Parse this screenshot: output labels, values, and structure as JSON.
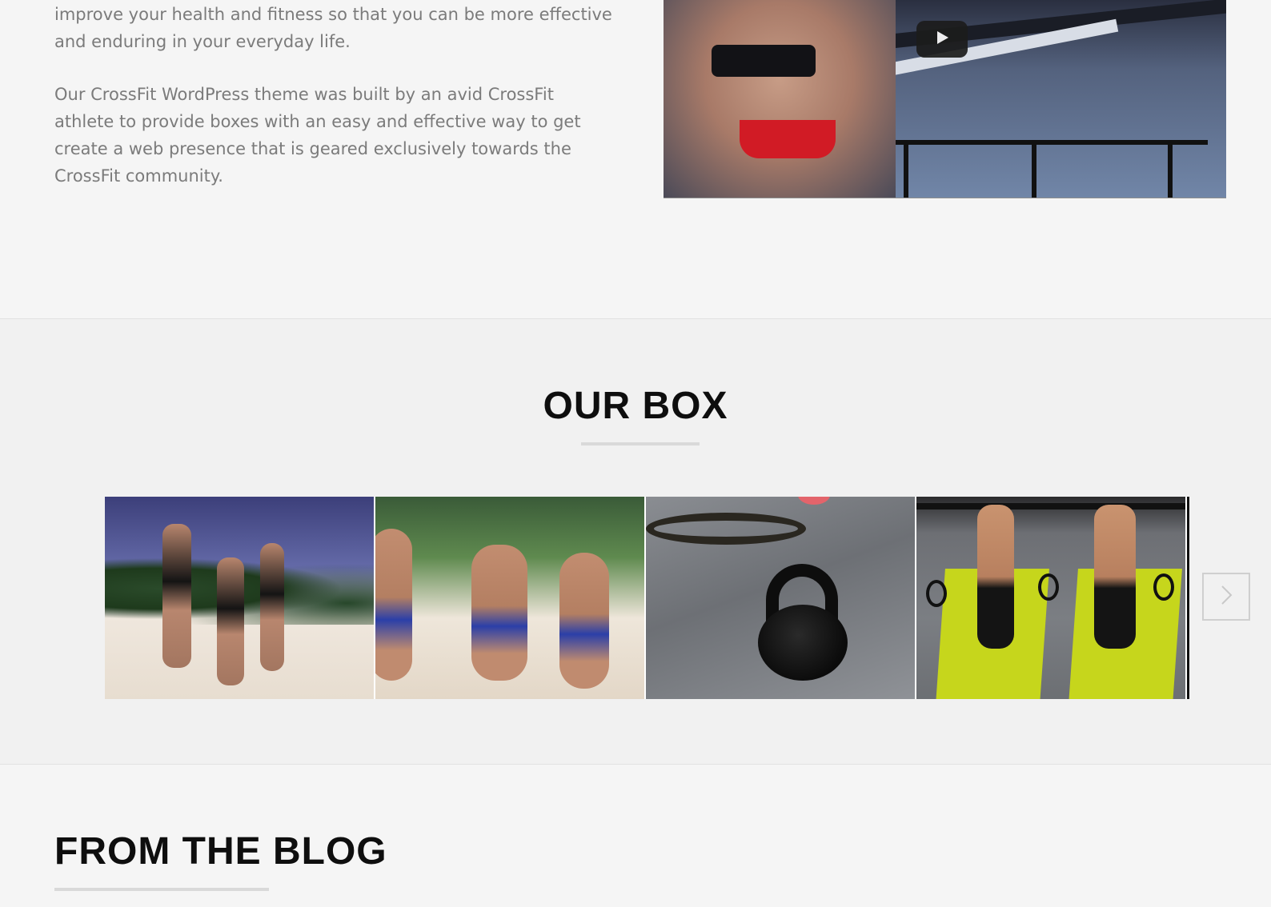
{
  "intro": {
    "paragraph1": "improve your health and fitness so that you can be more effective and enduring in your everyday life.",
    "paragraph2": "Our CrossFit WordPress theme was built by an avid CrossFit athlete to provide boxes with an easy and effective way to get create a web presence that is geared exclusively towards the CrossFit community.",
    "video": {
      "play_icon": "play-icon"
    }
  },
  "our_box": {
    "title": "OUR BOX",
    "next_icon": "chevron-right-icon",
    "accent_underline_color": "#d9d9d9"
  },
  "blog": {
    "title": "FROM THE BLOG"
  },
  "colors": {
    "background": "#f5f5f5",
    "section_alt_background": "#f1f1f1",
    "body_text": "#7b7b7b",
    "heading_text": "#0e0e0e"
  }
}
